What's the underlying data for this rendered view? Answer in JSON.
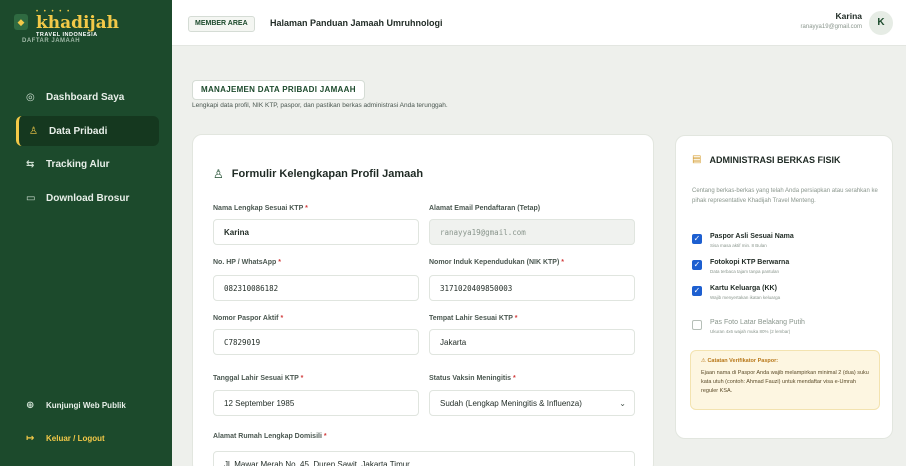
{
  "sidebar": {
    "brand": {
      "dots": "• • • • •",
      "name": "khadijah",
      "sub": "TRAVEL INDONESIA",
      "section": "DAFTAR JAMAAH"
    },
    "items": [
      {
        "label": "Dashboard Saya",
        "icon": "dashboard-icon"
      },
      {
        "label": "Data Pribadi",
        "icon": "user-icon",
        "active": true
      },
      {
        "label": "Tracking Alur",
        "icon": "route-icon"
      },
      {
        "label": "Download Brosur",
        "icon": "book-icon"
      }
    ],
    "bottom": [
      {
        "label": "Kunjungi Web Publik",
        "icon": "globe-icon"
      },
      {
        "label": "Keluar / Logout",
        "icon": "logout-icon"
      }
    ]
  },
  "header": {
    "badge": "MEMBER AREA",
    "title": "Halaman Panduan Jamaah Umruhnologi",
    "user_name": "Karina",
    "user_email": "ranayya19@gmail.com",
    "avatar_initial": "K"
  },
  "page": {
    "badge": "MANAJEMEN DATA PRIBADI JAMAAH",
    "subtitle": "Lengkapi data profil, NIK KTP, paspor, dan pastikan berkas administrasi Anda terunggah."
  },
  "form": {
    "title": "Formulir Kelengkapan Profil Jamaah",
    "fields": {
      "nama": {
        "label": "Nama Lengkap Sesuai KTP",
        "value": "Karina"
      },
      "email": {
        "label": "Alamat Email Pendaftaran (Tetap)",
        "value": "ranayya19@gmail.com"
      },
      "hp": {
        "label": "No. HP / WhatsApp",
        "value": "082310086182"
      },
      "nik": {
        "label": "Nomor Induk Kependudukan (NIK KTP)",
        "value": "3171020409850003"
      },
      "paspor": {
        "label": "Nomor Paspor Aktif",
        "value": "C7829019"
      },
      "tempat_lahir": {
        "label": "Tempat Lahir Sesuai KTP",
        "value": "Jakarta"
      },
      "tgl_lahir": {
        "label": "Tanggal Lahir Sesuai KTP",
        "value": "12 September 1985"
      },
      "vaksin": {
        "label": "Status Vaksin Meningitis",
        "value": "Sudah (Lengkap Meningitis & Influenza)"
      },
      "alamat": {
        "label": "Alamat Rumah Lengkap Domisili",
        "value": "Jl. Mawar Merah No. 45, Duren Sawit, Jakarta Timur"
      }
    }
  },
  "admin": {
    "title": "ADMINISTRASI BERKAS FISIK",
    "desc": "Centang berkas-berkas yang telah Anda persiapkan atau serahkan ke pihak representative Khadijah Travel Menteng.",
    "items": [
      {
        "title": "Paspor Asli Sesuai Nama",
        "sub": "Sisa masa aktif min. 8 Bulan",
        "checked": true
      },
      {
        "title": "Fotokopi KTP Berwarna",
        "sub": "Data terbaca tajam tanpa pantulan",
        "checked": true
      },
      {
        "title": "Kartu Keluarga (KK)",
        "sub": "Wajib menyertakan ikatan keluarga",
        "checked": true
      },
      {
        "title": "Pas Foto Latar Belakang Putih",
        "sub": "Ukuran 4x6 wajah muka 80% (2 lembar)",
        "checked": false
      }
    ],
    "note_title": "⚠ Catatan Verifikator Paspor:",
    "note_body": "Ejaan nama di Paspor Anda wajib melampirkan minimal 2 (dua) suku kata utuh (contoh: Ahmad Fauzi) untuk mendaftar visa e-Umrah reguler KSA."
  },
  "colors": {
    "sidebar": "#1c4a2c",
    "accent": "#f3c948",
    "checkbox": "#1d5fd0"
  }
}
